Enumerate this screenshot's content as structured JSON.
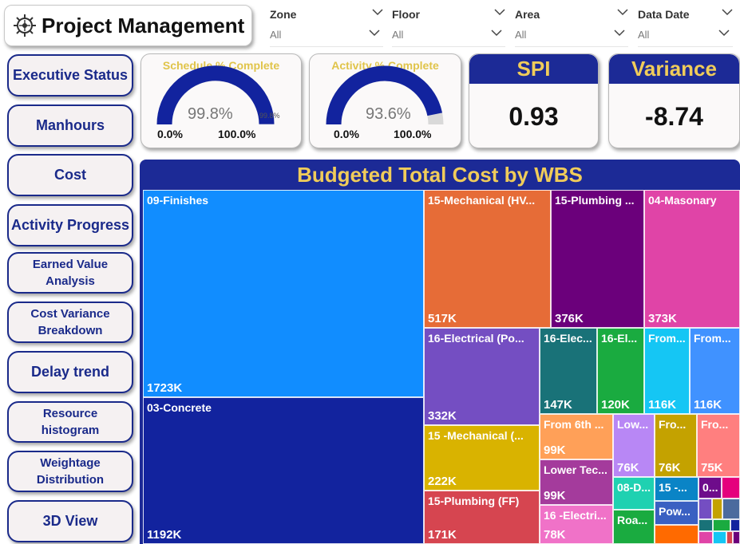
{
  "app": {
    "title": "Project Management"
  },
  "filters": [
    {
      "label": "Zone",
      "value": "All"
    },
    {
      "label": "Floor",
      "value": "All"
    },
    {
      "label": "Area",
      "value": "All"
    },
    {
      "label": "Data Date",
      "value": "All"
    }
  ],
  "nav": [
    "Executive Status",
    "Manhours",
    "Cost",
    "Activity Progress",
    "Earned Value Analysis",
    "Cost Variance Breakdown",
    "Delay trend",
    "Resource histogram",
    "Weightage Distribution",
    "3D View"
  ],
  "gauges": [
    {
      "title": "Schedule % Complete",
      "value": "99.8%",
      "min": "0.0%",
      "max": "100.0%",
      "target": "99.8%",
      "fraction": 0.998
    },
    {
      "title": "Activity % Complete",
      "value": "93.6%",
      "min": "0.0%",
      "max": "100.0%",
      "target": "",
      "fraction": 0.936
    }
  ],
  "kpis": [
    {
      "title": "SPI",
      "value": "0.93"
    },
    {
      "title": "Variance",
      "value": "-8.74"
    }
  ],
  "treemap": {
    "title": "Budgeted Total Cost by WBS",
    "tiles": [
      {
        "label": "09-Finishes",
        "value": "1723K",
        "color": "#118dff"
      },
      {
        "label": "03-Concrete",
        "value": "1192K",
        "color": "#12239e"
      },
      {
        "label": "15-Mechanical (HV...",
        "value": "517K",
        "color": "#e66c37"
      },
      {
        "label": "15-Plumbing ...",
        "value": "376K",
        "color": "#6b007b"
      },
      {
        "label": "04-Masonary",
        "value": "373K",
        "color": "#e044a7"
      },
      {
        "label": "16-Electrical (Po...",
        "value": "332K",
        "color": "#744ec2"
      },
      {
        "label": "16-Elec...",
        "value": "147K",
        "color": "#197278"
      },
      {
        "label": "16-El...",
        "value": "120K",
        "color": "#1aab40"
      },
      {
        "label": "From...",
        "value": "116K",
        "color": "#15c6f4"
      },
      {
        "label": "From...",
        "value": "116K",
        "color": "#4092ff"
      },
      {
        "label": "15 -Mechanical (...",
        "value": "222K",
        "color": "#d9b300"
      },
      {
        "label": "From 6th ...",
        "value": "99K",
        "color": "#ffa058"
      },
      {
        "label": "Low...",
        "value": "76K",
        "color": "#b887f5"
      },
      {
        "label": "Fro...",
        "value": "76K",
        "color": "#c4a200"
      },
      {
        "label": "Fro...",
        "value": "75K",
        "color": "#ff7f7f"
      },
      {
        "label": "Lower Tec...",
        "value": "99K",
        "color": "#a43b9c"
      },
      {
        "label": "08-D...",
        "value": "",
        "color": "#1fd1b1"
      },
      {
        "label": "15 -...",
        "value": "",
        "color": "#0a84c6"
      },
      {
        "label": "0...",
        "value": "",
        "color": "#6e0c8b"
      },
      {
        "label": "15-Plumbing (FF)",
        "value": "171K",
        "color": "#d64550"
      },
      {
        "label": "16 -Electri...",
        "value": "78K",
        "color": "#f072c8"
      },
      {
        "label": "Roa...",
        "value": "",
        "color": "#1aab40"
      },
      {
        "label": "Pow...",
        "value": "",
        "color": "#3a60c2"
      }
    ],
    "mini_colors": [
      "#e5007d",
      "#744ec2",
      "#c4a200",
      "#4b6b9e",
      "#ff6a00",
      "#197278",
      "#1aab40",
      "#12239e",
      "#e044a7",
      "#15c6f4",
      "#d64550",
      "#6b007b"
    ]
  }
}
